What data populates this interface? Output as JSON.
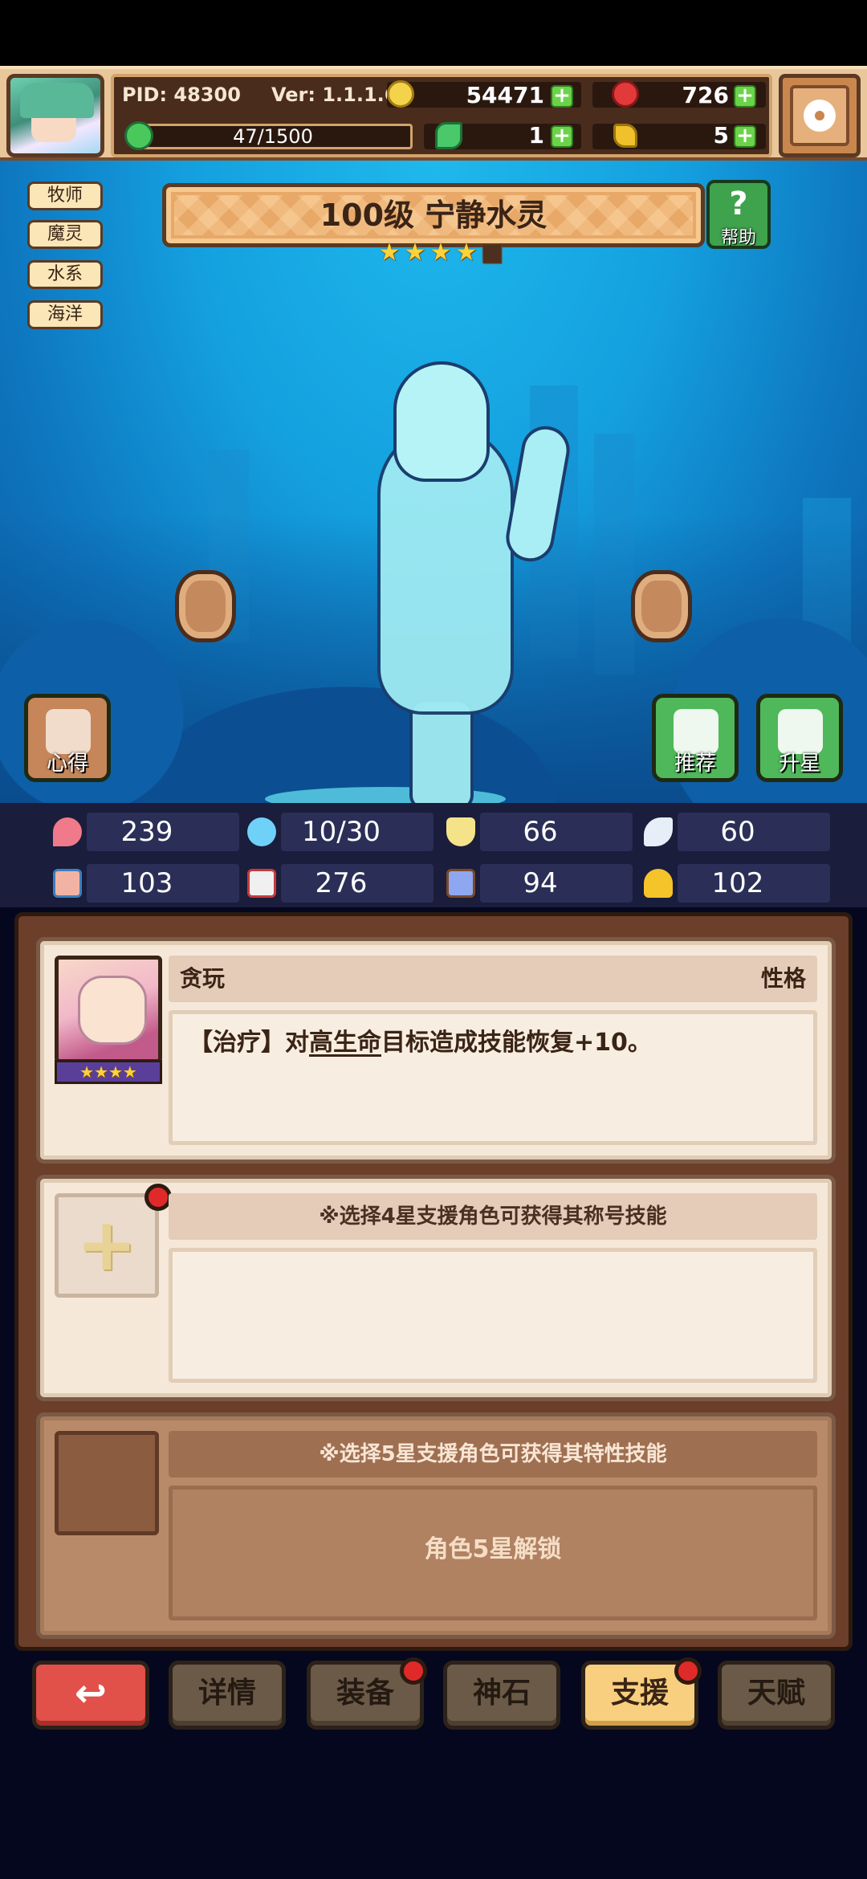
{
  "header": {
    "pid": "PID: 48300",
    "version": "Ver: 1.1.1.6",
    "coins": "54471",
    "rubies": "726",
    "exp": "47/1500",
    "clovers": "1",
    "keys": "5"
  },
  "tags": [
    "牧师",
    "魔灵",
    "水系",
    "海洋"
  ],
  "hero": {
    "title": "100级 宁静水灵",
    "stars_filled": 4,
    "stars_total": 5,
    "help_label": "帮助"
  },
  "scene_buttons": {
    "notes": "心得",
    "recommend": "推荐",
    "star_up": "升星"
  },
  "stats": [
    {
      "icon": "heart-icon",
      "value": "239",
      "color": "#f07a8a"
    },
    {
      "icon": "water-drop-icon",
      "value": "10/30",
      "color": "#6fd1f7"
    },
    {
      "icon": "shield-icon",
      "value": "66",
      "color": "#f5e38a"
    },
    {
      "icon": "wing-icon",
      "value": "60",
      "color": "#e6eef8"
    },
    {
      "icon": "fist-icon",
      "value": "103",
      "color": "#f3b3a4"
    },
    {
      "icon": "book-icon",
      "value": "276",
      "color": "#f0f0f0"
    },
    {
      "icon": "scroll-icon",
      "value": "94",
      "color": "#8fa7f0"
    },
    {
      "icon": "horseshoe-icon",
      "value": "102",
      "color": "#f5c32a"
    }
  ],
  "support": {
    "card1": {
      "name": "贪玩",
      "trait": "性格",
      "desc_prefix": "【治疗】对",
      "desc_underline": "高生命",
      "desc_suffix": "目标造成技能恢复+10。",
      "portrait_stars": 4
    },
    "card2": {
      "hint": "※选择4星支援角色可获得其称号技能"
    },
    "card3": {
      "hint": "※选择5星支援角色可获得其特性技能",
      "lock": "角色5星解锁"
    }
  },
  "nav": {
    "back": "↩",
    "details": "详情",
    "equipment": "装备",
    "godstone": "神石",
    "support": "支援",
    "talent": "天赋"
  },
  "colors": {
    "panel_brown": "#6b3f2a",
    "card_cream": "#f5e8d8",
    "active_tab": "#f7cf7e",
    "notification_red": "#e02a2a",
    "ocean_blue": "#14a0df"
  }
}
